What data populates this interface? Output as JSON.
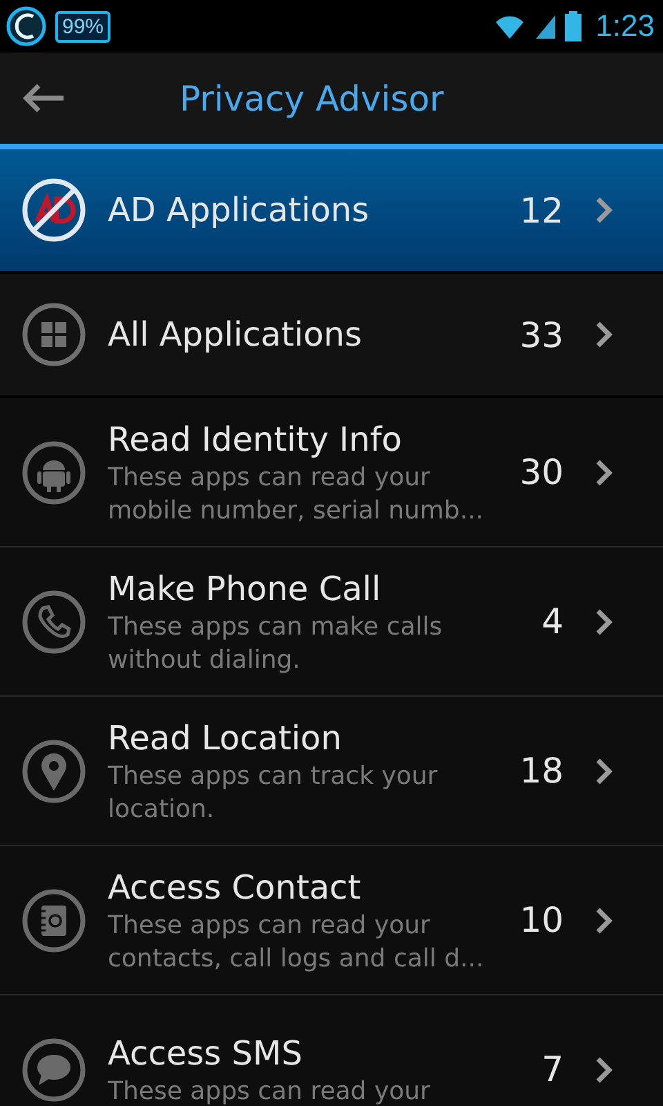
{
  "status_bar": {
    "battery_text": "99%",
    "time": "1:23"
  },
  "toolbar": {
    "title": "Privacy Advisor"
  },
  "categories": [
    {
      "label": "AD Applications",
      "count": "12",
      "selected": true
    },
    {
      "label": "All Applications",
      "count": "33",
      "selected": false
    }
  ],
  "permissions": [
    {
      "title": "Read Identity Info",
      "description": "These apps can read your mobile number, serial numb...",
      "count": "30"
    },
    {
      "title": "Make Phone Call",
      "description": "These apps can make calls without dialing.",
      "count": "4"
    },
    {
      "title": "Read Location",
      "description": "These apps can track your location.",
      "count": "18"
    },
    {
      "title": "Access Contact",
      "description": "These apps can read your contacts, call logs and call d...",
      "count": "10"
    },
    {
      "title": "Access SMS",
      "description": "These apps can read your",
      "count": "7"
    }
  ]
}
